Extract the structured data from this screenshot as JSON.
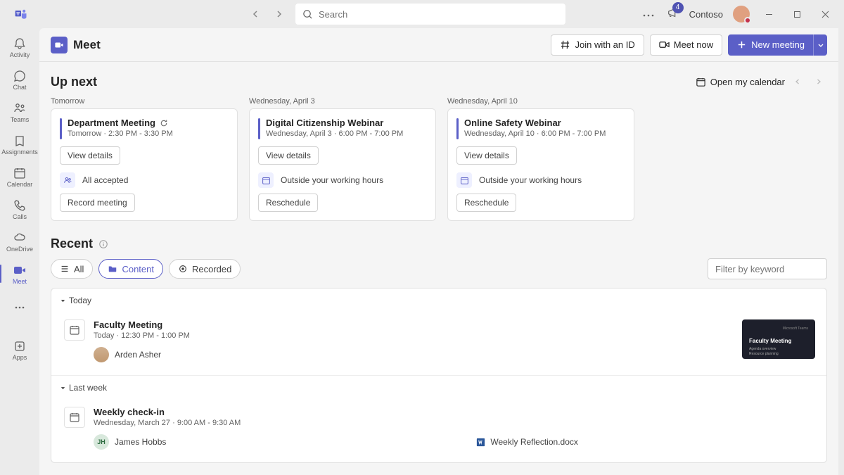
{
  "titlebar": {
    "search_placeholder": "Search",
    "notif_count": "4",
    "org_name": "Contoso"
  },
  "rail": {
    "activity": "Activity",
    "chat": "Chat",
    "teams": "Teams",
    "assignments": "Assignments",
    "calendar": "Calendar",
    "calls": "Calls",
    "onedrive": "OneDrive",
    "meet": "Meet",
    "apps": "Apps"
  },
  "header": {
    "title": "Meet",
    "join_id": "Join with an ID",
    "meet_now": "Meet now",
    "new_meeting": "New meeting"
  },
  "upnext": {
    "title": "Up next",
    "open_calendar": "Open my calendar",
    "days": [
      {
        "label": "Tomorrow",
        "card": {
          "title": "Department Meeting",
          "recurring": true,
          "time": "Tomorrow · 2:30 PM - 3:30 PM",
          "view": "View details",
          "status_icon": "people",
          "status": "All accepted",
          "action": "Record meeting"
        }
      },
      {
        "label": "Wednesday, April 3",
        "card": {
          "title": "Digital Citizenship Webinar",
          "recurring": false,
          "time": "Wednesday, April 3 · 6:00 PM - 7:00 PM",
          "view": "View details",
          "status_icon": "calendar",
          "status": "Outside your working hours",
          "action": "Reschedule"
        }
      },
      {
        "label": "Wednesday, April 10",
        "card": {
          "title": "Online Safety Webinar",
          "recurring": false,
          "time": "Wednesday, April 10 · 6:00 PM - 7:00 PM",
          "view": "View details",
          "status_icon": "calendar",
          "status": "Outside your working hours",
          "action": "Reschedule"
        }
      }
    ]
  },
  "recent": {
    "title": "Recent",
    "filters": {
      "all": "All",
      "content": "Content",
      "recorded": "Recorded"
    },
    "filter_placeholder": "Filter by keyword",
    "groups": [
      {
        "label": "Today",
        "item": {
          "title": "Faculty Meeting",
          "time": "Today · 12:30 PM - 1:00 PM",
          "person": "Arden Asher",
          "thumb_title": "Faculty Meeting"
        }
      },
      {
        "label": "Last week",
        "item": {
          "title": "Weekly check-in",
          "time": "Wednesday, March 27 · 9:00 AM - 9:30 AM",
          "person": "James Hobbs",
          "person_initials": "JH",
          "attachment": "Weekly Reflection.docx"
        }
      }
    ]
  }
}
